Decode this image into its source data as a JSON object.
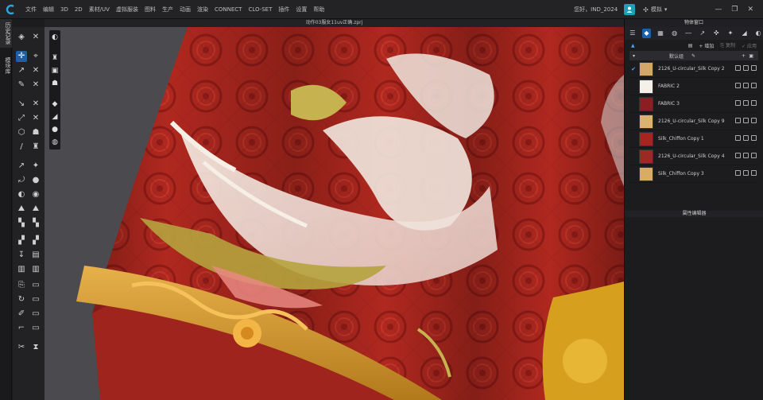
{
  "menubar": {
    "items": [
      "文件",
      "编辑",
      "3D",
      "2D",
      "素材/UV",
      "虚拟服装",
      "图料",
      "生产",
      "动画",
      "渲染",
      "CONNECT",
      "CLO-SET",
      "插件",
      "设置",
      "帮助"
    ],
    "user_text": "您好，IND_2024",
    "mode_label": "模拟",
    "win_controls": [
      "▾",
      "—",
      "❐",
      "✕"
    ]
  },
  "left_tabs": [
    "历史记录",
    "模块库"
  ],
  "document": {
    "title": "动作03服女11uv正确.zprj"
  },
  "object_browser": {
    "title": "物体窗口",
    "add_label": "增加",
    "copy_label": "复制",
    "apply_label": "应用",
    "group_label": "默认组",
    "fabrics": [
      {
        "name": "2126_U-circular_Silk Copy 2",
        "color": "#d2a76a",
        "checked": true
      },
      {
        "name": "FABRIC 2",
        "color": "#f5f1ea",
        "checked": false
      },
      {
        "name": "FABRIC 3",
        "color": "#8a1e22",
        "checked": false
      },
      {
        "name": "2126_U-circular_Silk Copy 9",
        "color": "#dcb272",
        "checked": false
      },
      {
        "name": "Silk_Chiffon Copy 1",
        "color": "#a82420",
        "checked": false
      },
      {
        "name": "2126_U-circular_Silk Copy 4",
        "color": "#9c2a24",
        "checked": false
      },
      {
        "name": "Silk_Chiffon Copy 3",
        "color": "#d9ac64",
        "checked": false
      }
    ]
  },
  "property_editor": {
    "title": "属性编辑器"
  }
}
